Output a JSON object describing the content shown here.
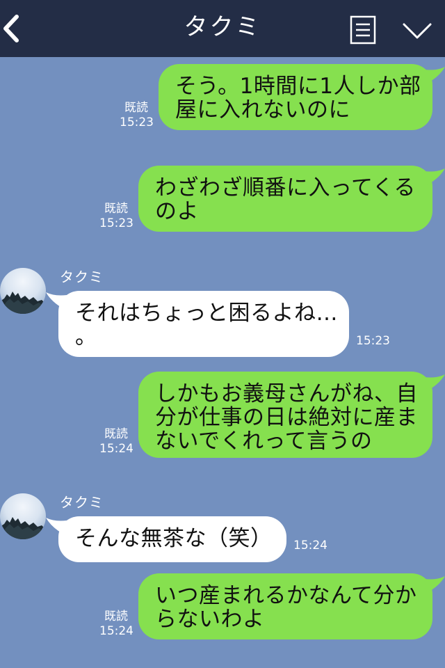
{
  "header": {
    "title": "タクミ",
    "back_icon": "chevron-left-icon",
    "menu_icon": "document-list-icon",
    "expand_icon": "chevron-down-icon"
  },
  "colors": {
    "header_bg": "#232d46",
    "chat_bg": "#7390bf",
    "outgoing_bubble": "#86e04f",
    "incoming_bubble": "#ffffff"
  },
  "messages": [
    {
      "direction": "out",
      "text": "そう。1時間に1人しか部\n屋に入れないのに",
      "read": "既読",
      "time": "15:23"
    },
    {
      "direction": "out",
      "text": "わざわざ順番に入ってくる\nのよ",
      "read": "既読",
      "time": "15:23"
    },
    {
      "direction": "in",
      "sender": "タクミ",
      "text": "それはちょっと困るよね…\n。",
      "time": "15:23"
    },
    {
      "direction": "out",
      "text": "しかもお義母さんがね、自\n分が仕事の日は絶対に産ま\nないでくれって言うの",
      "read": "既読",
      "time": "15:24"
    },
    {
      "direction": "in",
      "sender": "タクミ",
      "text": "そんな無茶な（笑）",
      "time": "15:24"
    },
    {
      "direction": "out",
      "text": "いつ産まれるかなんて分か\nらないわよ",
      "read": "既読",
      "time": "15:24"
    }
  ]
}
